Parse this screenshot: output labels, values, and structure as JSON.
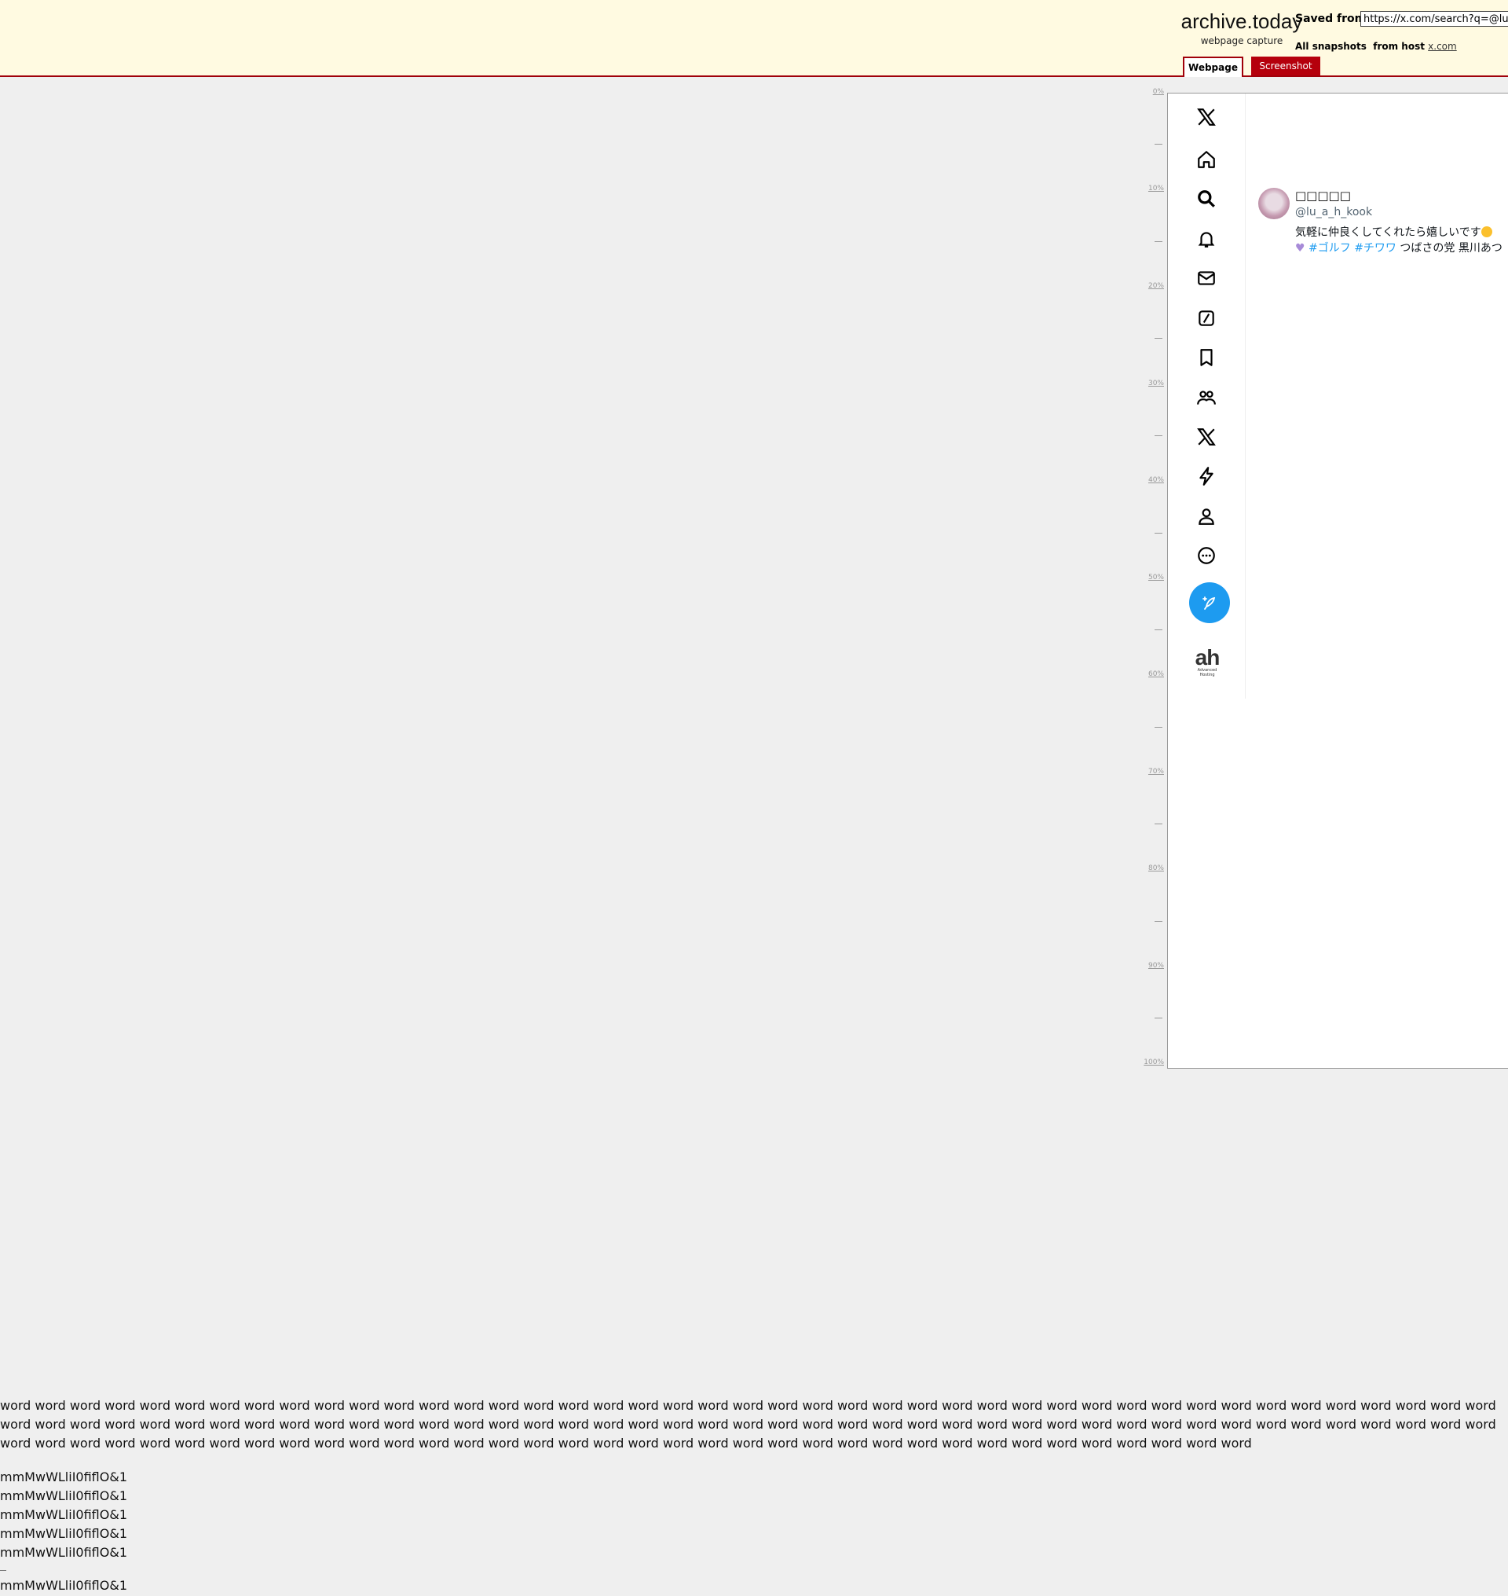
{
  "header": {
    "brand_title": "archive.today",
    "brand_subtitle": "webpage capture",
    "saved_from_label": "Saved from",
    "url_value": "https://x.com/search?q=@lu_a",
    "all_snapshots_label": "All snapshots",
    "from_host_label": "from host",
    "host_link": "x.com",
    "tabs": [
      {
        "label": "Webpage",
        "active": true
      },
      {
        "label": "Screenshot",
        "active": false
      }
    ],
    "accent_color": "#a0000a",
    "background_color": "#fffae1"
  },
  "ruler": {
    "labels": [
      "0%",
      "10%",
      "20%",
      "30%",
      "40%",
      "50%",
      "60%",
      "70%",
      "80%",
      "90%",
      "100%"
    ]
  },
  "sidebar": {
    "icons": [
      "x-logo-icon",
      "home-icon",
      "search-icon",
      "notifications-icon",
      "messages-icon",
      "grok-icon",
      "bookmarks-icon",
      "communities-icon",
      "premium-icon",
      "verified-orgs-icon",
      "profile-icon",
      "more-icon"
    ],
    "compose_color": "#1d9bf0",
    "sponsor_logo_text": "ah",
    "sponsor_logo_sub1": "Advanced",
    "sponsor_logo_sub2": "Hosting"
  },
  "profile": {
    "display_name": "□□□□□",
    "handle": "@lu_a_h_kook",
    "bio_line1": "気軽に仲良くしてくれたら嬉しいです",
    "bio_hashtag1": "#ゴルフ",
    "bio_hashtag2": "#チワワ",
    "bio_line2_rest": "つばさの党 黒川あつ"
  },
  "body_text": {
    "words": "word word word word word word word word word word word word word word word word word word word word word word word word word word word word word word word word word word word word word word word word word word word word word word word word word word word word word word word word word word word word word word word word word word word word word word word word word word word word word word word word word word word word word word word word word word word word word word word word word word word word word word word word word word word word word word word word word word word word word word word word word word",
    "glyph_lines": [
      "mmMwWLliI0fiflO&1",
      "mmMwWLliI0fiflO&1",
      "mmMwWLliI0fiflO&1",
      "mmMwWLliI0fiflO&1",
      "mmMwWLliI0fiflO&1",
      "mmMwWLliI0fiflO&1"
    ]
  }
}
